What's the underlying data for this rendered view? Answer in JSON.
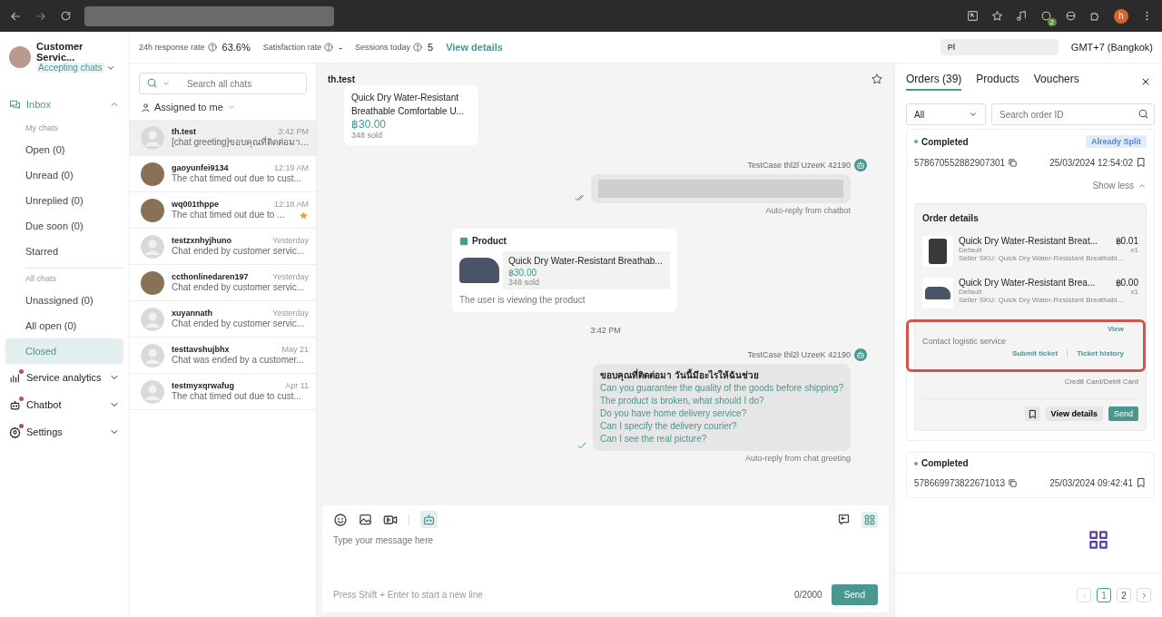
{
  "browser": {
    "extension_badge": "2",
    "profile_initial": "h"
  },
  "sidebar": {
    "account": {
      "name": "Customer Servic...",
      "status": "Accepting chats"
    },
    "sections": [
      {
        "kind": "inbox",
        "label": "Inbox",
        "expanded": true,
        "notify": false,
        "groups": [
          {
            "heading": "My chats",
            "items": [
              {
                "label": "Open (0)",
                "selected": false
              },
              {
                "label": "Unread (0)",
                "selected": false
              },
              {
                "label": "Unreplied (0)",
                "selected": false
              },
              {
                "label": "Due soon (0)",
                "selected": false
              },
              {
                "label": "Starred",
                "selected": false
              }
            ]
          },
          {
            "heading": "All chats",
            "items": [
              {
                "label": "Unassigned (0)",
                "selected": false
              },
              {
                "label": "All open (0)",
                "selected": false
              },
              {
                "label": "Closed",
                "selected": true
              }
            ]
          }
        ]
      },
      {
        "kind": "analytics",
        "label": "Service analytics",
        "expanded": false,
        "notify": true
      },
      {
        "kind": "chatbot",
        "label": "Chatbot",
        "expanded": false,
        "notify": true
      },
      {
        "kind": "settings",
        "label": "Settings",
        "expanded": false,
        "notify": true
      }
    ]
  },
  "stats": [
    {
      "label": "24h response rate",
      "value": "63.6%"
    },
    {
      "label": "Satisfaction rate",
      "value": "-"
    },
    {
      "label": "Sessions today",
      "value": "5"
    }
  ],
  "view_details": "View details",
  "store_label": "Pl",
  "timezone": "GMT+7 (Bangkok)",
  "chat_list": {
    "search_placeholder": "Search all chats",
    "filter": "Assigned to me",
    "conversations": [
      {
        "name": "th.test",
        "time": "3:42 PM",
        "preview": "[chat greeting]ขอบคุณที่ติดต่อมา...",
        "selected": true,
        "starred": false,
        "kind": "default"
      },
      {
        "name": "gaoyunfei9134",
        "time": "12:19 AM",
        "preview": "The chat timed out due to cust...",
        "selected": false,
        "starred": false,
        "kind": "photo"
      },
      {
        "name": "wq001thppe",
        "time": "12:18 AM",
        "preview": "The chat timed out due to ...",
        "selected": false,
        "starred": true,
        "kind": "photo"
      },
      {
        "name": "testzxnhyjhuno",
        "time": "Yesterday",
        "preview": "Chat ended by customer servic...",
        "selected": false,
        "starred": false,
        "kind": "default"
      },
      {
        "name": "ccthonlinedaren197",
        "time": "Yesterday",
        "preview": "Chat ended by customer servic...",
        "selected": false,
        "starred": false,
        "kind": "photo"
      },
      {
        "name": "xuyannath",
        "time": "Yesterday",
        "preview": "Chat ended by customer servic...",
        "selected": false,
        "starred": false,
        "kind": "default"
      },
      {
        "name": "testtavshujbhx",
        "time": "May 21",
        "preview": "Chat was ended by a customer...",
        "selected": false,
        "starred": false,
        "kind": "default"
      },
      {
        "name": "testmyxqrwafug",
        "time": "Apr 11",
        "preview": "The chat timed out due to cust...",
        "selected": false,
        "starred": false,
        "kind": "default"
      }
    ]
  },
  "chat": {
    "title": "th.test",
    "starred": false,
    "messages": [
      {
        "kind": "product_card",
        "name": "Quick Dry Water-Resistant Breathable Comfortable U...",
        "price": "฿30.00",
        "sold": "348 sold"
      },
      {
        "kind": "bot_blurred",
        "sender": "TestCase thl2l UzeeK 42190",
        "read": true,
        "caption": "Auto-reply from chatbot"
      },
      {
        "kind": "product_view",
        "title": "Product",
        "name": "Quick Dry Water-Resistant Breathab...",
        "price": "฿30.00",
        "sold": "348 sold",
        "note": "The user is viewing the product"
      },
      {
        "kind": "time",
        "text": "3:42 PM"
      },
      {
        "kind": "bot_text",
        "sender": "TestCase thl2l UzeeK 42190",
        "read": false,
        "greeting": "ขอบคุณที่ติดต่อมา วันนี้มีอะไรให้ฉันช่วย",
        "questions": [
          "Can you guarantee the quality of the goods before shipping?",
          "The product is broken, what should I do?",
          "Do you have home delivery service?",
          "Can I specify the delivery courier?",
          "Can I see the real picture?"
        ],
        "caption": "Auto-reply from chat greeting"
      }
    ],
    "composer": {
      "placeholder": "Type your message here",
      "hint": "Press Shift + Enter to start a new line",
      "counter": "0/2000",
      "send": "Send"
    }
  },
  "orders": {
    "tabs": [
      {
        "label": "Orders (39)",
        "selected": true
      },
      {
        "label": "Products",
        "selected": false
      },
      {
        "label": "Vouchers",
        "selected": false
      }
    ],
    "filter": "All",
    "search_placeholder": "Search order ID",
    "list": [
      {
        "status": "Completed",
        "badge": "Already Split",
        "id": "578670552882907301",
        "date": "25/03/2024 12:54:02",
        "expanded": true,
        "toggle": "Show less",
        "details": {
          "title": "Order details",
          "items": [
            {
              "kind": "shirt",
              "name": "Quick Dry Water-Resistant Breat...",
              "price": "฿0.01",
              "variant": "Default",
              "qty": "x1",
              "sku": "Seller SKU: Quick Dry Water-Resistant Breathabl..."
            },
            {
              "kind": "shoe",
              "name": "Quick Dry Water-Resistant Brea...",
              "price": "฿0.00",
              "variant": "Default",
              "qty": "x1",
              "sku": "Seller SKU: Quick Dry Water-Resistant Breathabl..."
            }
          ],
          "highlighted": true,
          "view": "View",
          "contact": "Contact logistic service",
          "submit_ticket": "Submit ticket",
          "ticket_history": "Ticket history",
          "payment": "Credit Card/Debit Card",
          "view_details": "View details",
          "send": "Send"
        }
      },
      {
        "status": "Completed",
        "id": "578669973822671013",
        "date": "25/03/2024 09:42:41",
        "expanded": false
      }
    ],
    "pages": [
      {
        "label": "1",
        "selected": true
      },
      {
        "label": "2",
        "selected": false
      }
    ]
  }
}
